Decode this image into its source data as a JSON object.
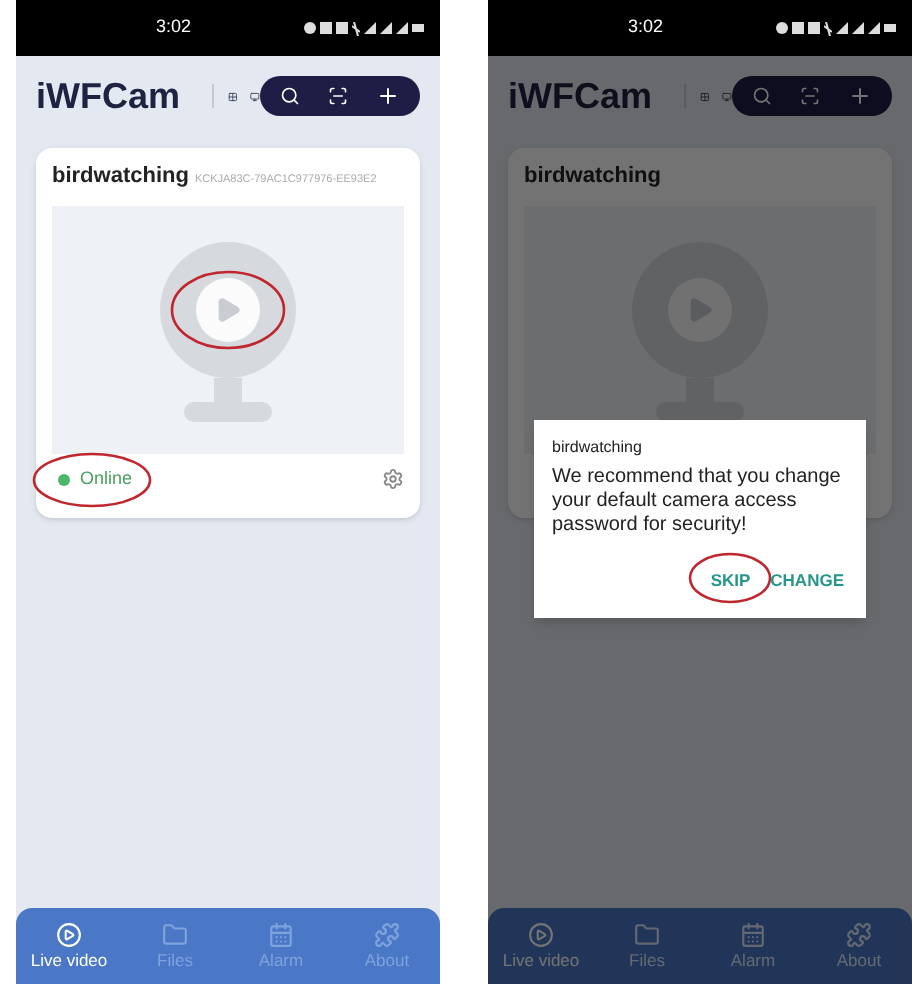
{
  "phones": [
    {
      "status_bar": {
        "time": "3:02"
      },
      "app_title": "iWFCam",
      "camera": {
        "name": "birdwatching",
        "id": "KCKJA83C-79AC1C977976-EE93E2",
        "status": "Online",
        "online": true,
        "play_circled": true,
        "status_circled": true
      },
      "nav": [
        {
          "label": "Live video",
          "selected": true
        },
        {
          "label": "Files",
          "selected": false
        },
        {
          "label": "Alarm",
          "selected": false
        },
        {
          "label": "About",
          "selected": false
        }
      ]
    },
    {
      "status_bar": {
        "time": "3:02"
      },
      "app_title": "iWFCam",
      "dimmed": true,
      "camera": {
        "name": "birdwatching"
      },
      "nav": [
        {
          "label": "Live video",
          "selected": true
        },
        {
          "label": "Files",
          "selected": false
        },
        {
          "label": "Alarm",
          "selected": false
        },
        {
          "label": "About",
          "selected": false
        }
      ],
      "dialog": {
        "title": "birdwatching",
        "message": "We recommend that you change your default camera access password for security!",
        "buttons": [
          {
            "label": "SKIP",
            "circled": true
          },
          {
            "label": "CHANGE",
            "circled": false
          }
        ]
      }
    }
  ]
}
